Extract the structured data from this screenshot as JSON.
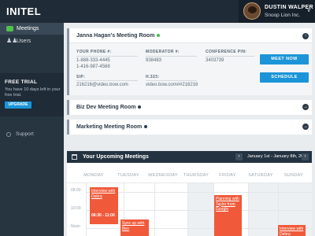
{
  "app": {
    "logo": "INITEL"
  },
  "user": {
    "name": "DUSTIN WALPER",
    "company": "Snoop Lion Inc.",
    "caret": "v"
  },
  "sidebar": {
    "items": [
      {
        "label": "Meetings"
      },
      {
        "label": "Users"
      }
    ],
    "trial": {
      "title": "FREE TRIAL",
      "text": "You have 10 days left in your free trial.",
      "button": "UPGRADE"
    },
    "support": "Support"
  },
  "rooms": [
    {
      "title": "Janna Hagan's Meeting Room",
      "status_color": "#3cc24a",
      "phone_label": "YOUR PHONE #:",
      "phones": [
        "1-888-333-4445",
        "1-416-987-4568"
      ],
      "moderator_label": "MODERATOR #:",
      "moderator": "938483",
      "pin_label": "CONFERENCE PIN:",
      "pin": "3403739",
      "sip_label": "SIP:",
      "sip": "216216@video.bow.com",
      "h323_label": "H.323:",
      "h323": "video.bow.com##216216",
      "meet_now": "MEET NOW",
      "schedule": "SCHEDULE"
    },
    {
      "title": "Biz Dev Meeting Room",
      "status_color": "#2b3a47"
    },
    {
      "title": "Marketing Meeting Room",
      "status_color": "#2b3a47"
    }
  ],
  "calendar": {
    "title": "Your Upcoming Meetings",
    "range": "January 1st - January 8th, 2013",
    "prev": "‹",
    "next": "›",
    "days": [
      "MONDAY",
      "TUESDAY",
      "WEDNESDAY",
      "THURSDAY",
      "FRIDAY",
      "SATURDAY",
      "SUNDAY"
    ],
    "times": [
      "08:00",
      "10:00",
      "Noon"
    ],
    "events": [
      {
        "title": "Interview with Debra",
        "time": "08:30 - 11:00"
      },
      {
        "title": "Sync up with Ben"
      },
      {
        "title": "Planning with Taylor from Google"
      },
      {
        "title": "Interview with Debra"
      }
    ]
  },
  "colors": {
    "accent": "#1b95d8",
    "event": "#f05a3a",
    "online": "#3cc24a"
  }
}
